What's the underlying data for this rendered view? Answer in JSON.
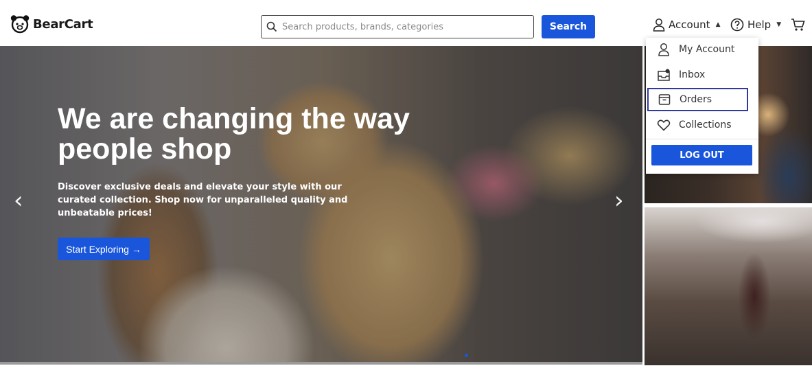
{
  "brand": {
    "name": "BearCart"
  },
  "search": {
    "placeholder": "Search products, brands, categories",
    "button": "Search"
  },
  "nav": {
    "account": "Account",
    "help": "Help"
  },
  "dropdown": {
    "items": [
      {
        "label": "My Account",
        "icon": "user-icon"
      },
      {
        "label": "Inbox",
        "icon": "inbox-icon"
      },
      {
        "label": "Orders",
        "icon": "box-icon",
        "focused": true
      },
      {
        "label": "Collections",
        "icon": "heart-icon"
      }
    ],
    "logout": "LOG OUT"
  },
  "hero": {
    "title": "We are changing the way people shop",
    "subtitle": "Discover exclusive deals and elevate your style with our curated collection. Shop now for unparalleled quality and unbeatable prices!",
    "cta": "Start Exploring →",
    "prev": "‹",
    "next": "›"
  },
  "colors": {
    "accent": "#1a56db",
    "focus_border": "#2f3aa0"
  }
}
